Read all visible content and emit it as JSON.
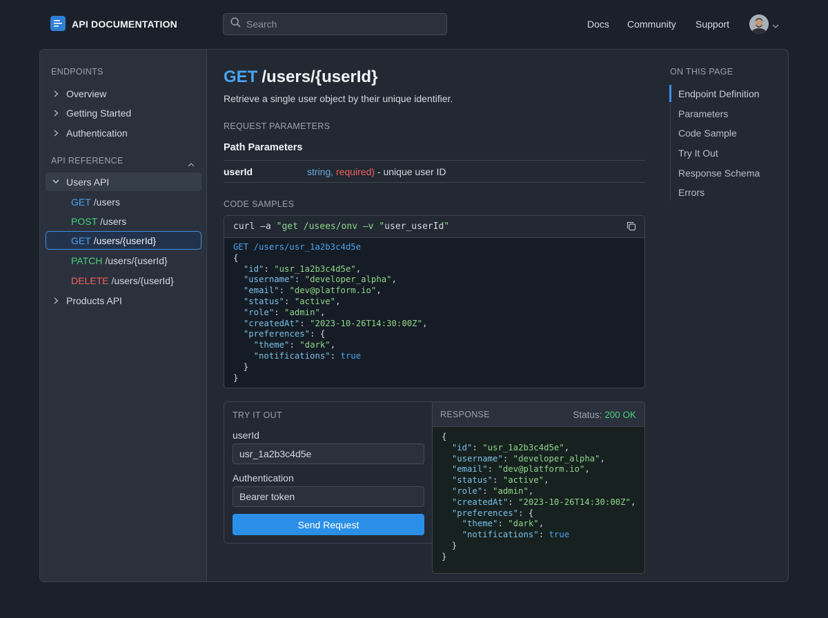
{
  "header": {
    "logo_text": "API DOCUMENTATION",
    "search_placeholder": "Search",
    "nav": [
      "Docs",
      "Community",
      "Support"
    ]
  },
  "sidebar": {
    "section1_label": "ENDPOINTS",
    "section1_items": [
      "Overview",
      "Getting Started",
      "Authentication"
    ],
    "section2_label": "API REFERENCE",
    "group_label": "Users API",
    "endpoints": [
      {
        "method": "GET",
        "path": "/users"
      },
      {
        "method": "POST",
        "path": "/users"
      },
      {
        "method": "GET",
        "path": "/users/{userId}"
      },
      {
        "method": "PATCH",
        "path": "/users/{userId}"
      },
      {
        "method": "DELETE",
        "path": "/users/{userId}"
      }
    ],
    "products_label": "Products API"
  },
  "content": {
    "title_method": "GET",
    "title_path": "/users/{userId}",
    "description": "Retrieve a single user object by their unique identifier.",
    "request_params_label": "REQUEST PARAMETERS",
    "path_params_label": "Path Parameters",
    "param": {
      "name": "userId",
      "type": "string,",
      "required": "required)",
      "desc": "- unique user ID"
    },
    "code_samples_label": "CODE SAMPLES",
    "curl_line": "curl –a \"get /usees/onv –v \"user_userId\"",
    "request_line": "GET /users/usr_1a2b3c4d5e",
    "json": {
      "id": "\"usr_1a2b3c4d5e\"",
      "username": "\"developer_alpha\"",
      "email": "\"dev@platform.io\"",
      "status": "\"active\"",
      "role": "\"admin\"",
      "createdAt": "\"2023-10-26T14:30:00Z\"",
      "theme": "\"dark\"",
      "notifications": "true"
    },
    "try_it_out_label": "TRY IT OUT",
    "userid_label": "userId",
    "userid_value": "usr_1a2b3c4d5e",
    "auth_label": "Authentication",
    "auth_value": "Bearer token",
    "send_button": "Send Request",
    "response_label": "RESPONSE",
    "status_label": "Status:",
    "status_value": "200 OK"
  },
  "toc": {
    "label": "ON THIS PAGE",
    "items": [
      "Endpoint Definition",
      "Parameters",
      "Code Sample",
      "Try It Out",
      "Response Schema",
      "Errors"
    ]
  },
  "colors": {
    "accent": "#3d8ee8",
    "get": "#4aa3f0",
    "post": "#49cf80",
    "delete": "#f0605c",
    "success": "#49cf80"
  },
  "icons": [
    "menu-doc-icon",
    "search-icon",
    "chevron-down-icon",
    "chevron-right-icon",
    "chevron-up-icon",
    "copy-icon",
    "avatar"
  ]
}
